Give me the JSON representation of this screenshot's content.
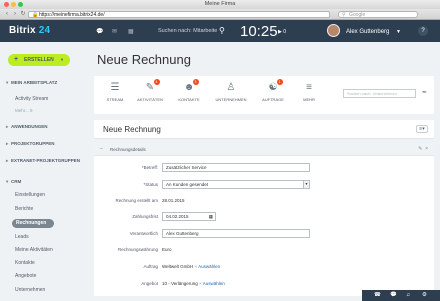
{
  "window": {
    "title": "Meine Firma"
  },
  "browser": {
    "url": "https://meinefirma.bitrix24.de/",
    "search_placeholder": "Google"
  },
  "header": {
    "logo_text": "Bitrix",
    "logo_num": "24",
    "search_label": "Suchen nach: Mitarbeite",
    "clock": "10:25",
    "status_count": "0",
    "user_name": "Alex Guttenberg",
    "help": "?"
  },
  "sidebar": {
    "create_label": "ERSTELLEN",
    "sections": {
      "workplace": "MEIN ARBEITSPLATZ",
      "apps": "ANWENDUNGEN",
      "projects": "PROJEKTGRUPPEN",
      "extranet": "EXTRANET-PROJEKTGRUPPEN",
      "crm": "CRM"
    },
    "items": {
      "activity_stream": "Activity Stream",
      "more": "Mehr...",
      "settings": "Einstellungen",
      "reports": "Berichte",
      "invoices": "Rechnungen",
      "leads": "Leads",
      "my_activities": "Meine Aktivitäten",
      "contacts": "Kontakte",
      "quotes": "Angebote",
      "companies": "Unternehmen"
    },
    "more_count": "9"
  },
  "main": {
    "page_title": "Neue Rechnung",
    "toolbar": {
      "items": [
        {
          "label": "STREAM",
          "badge": ""
        },
        {
          "label": "AKTIVITÄTEN",
          "badge": "4"
        },
        {
          "label": "KONTAKTE",
          "badge": "3"
        },
        {
          "label": "UNTERNEHMEN",
          "badge": ""
        },
        {
          "label": "AUFTRÄGE",
          "badge": "1"
        },
        {
          "label": "MEHR",
          "badge": ""
        }
      ],
      "search_placeholder": "Suchen nach: Unternehmen"
    },
    "card_title": "Neue Rechnung",
    "form": {
      "section_title": "Rechnungsdetails",
      "fields": {
        "subject_label": "*Betreff:",
        "subject_value": "Zusätzlicher Service",
        "status_label": "*Status",
        "status_value": "An Kunden gesendet",
        "created_label": "Rechnung erstellt am",
        "created_value": "28.01.2015",
        "due_label": "Zahlungsfrist",
        "due_value": "04.02.2015",
        "responsible_label": "Verantwortlich",
        "responsible_value": "Alex Guttenberg",
        "currency_label": "Rechnungswährung",
        "currency_value": "Euro",
        "deal_label": "Auftrag",
        "deal_value": "Weltwelt GmbH",
        "deal_action": "Auswählen",
        "quote_label": "Angebot",
        "quote_value": "10 - Verlängerung",
        "quote_action": "Auswählen"
      }
    }
  }
}
